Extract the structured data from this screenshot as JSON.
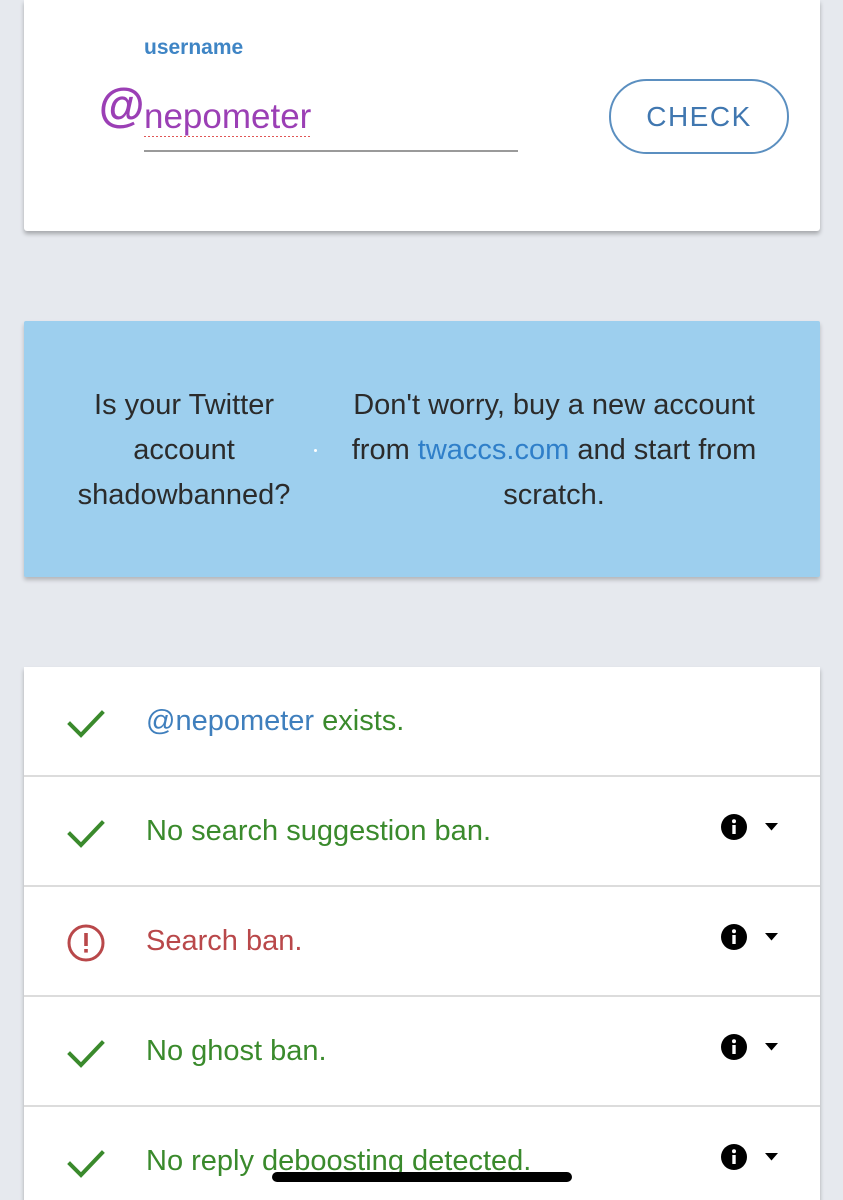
{
  "colors": {
    "page_bg": "#e6e9ee",
    "purple": "#9b3fb5",
    "label_blue": "#3f85c5",
    "button_border": "#5b8fc0",
    "button_text": "#4077b0",
    "ad_bg": "#9dcfee",
    "link_blue": "#2f7fc9",
    "success_green": "#3a8a2c",
    "error_red": "#b9484a",
    "username_blue": "#3f7fbd"
  },
  "search": {
    "at_symbol": "@",
    "label": "username",
    "value": "nepometer",
    "button_label": "CHECK"
  },
  "ad": {
    "left_text": "Is your Twitter account shadowbanned?",
    "right_prefix": "Don't worry, buy a new account from ",
    "link_text": "twaccs.com",
    "right_suffix": " and start from scratch."
  },
  "results": [
    {
      "status": "ok",
      "icon": "check-icon",
      "username": "@nepometer",
      "text": " exists.",
      "has_info": false
    },
    {
      "status": "ok",
      "icon": "check-icon",
      "text": "No search suggestion ban.",
      "has_info": true
    },
    {
      "status": "ban",
      "icon": "alert-circle-icon",
      "text": "Search ban.",
      "has_info": true
    },
    {
      "status": "ok",
      "icon": "check-icon",
      "text": "No ghost ban.",
      "has_info": true
    },
    {
      "status": "ok",
      "icon": "check-icon",
      "text": "No reply deboosting detected.",
      "has_info": true
    }
  ]
}
